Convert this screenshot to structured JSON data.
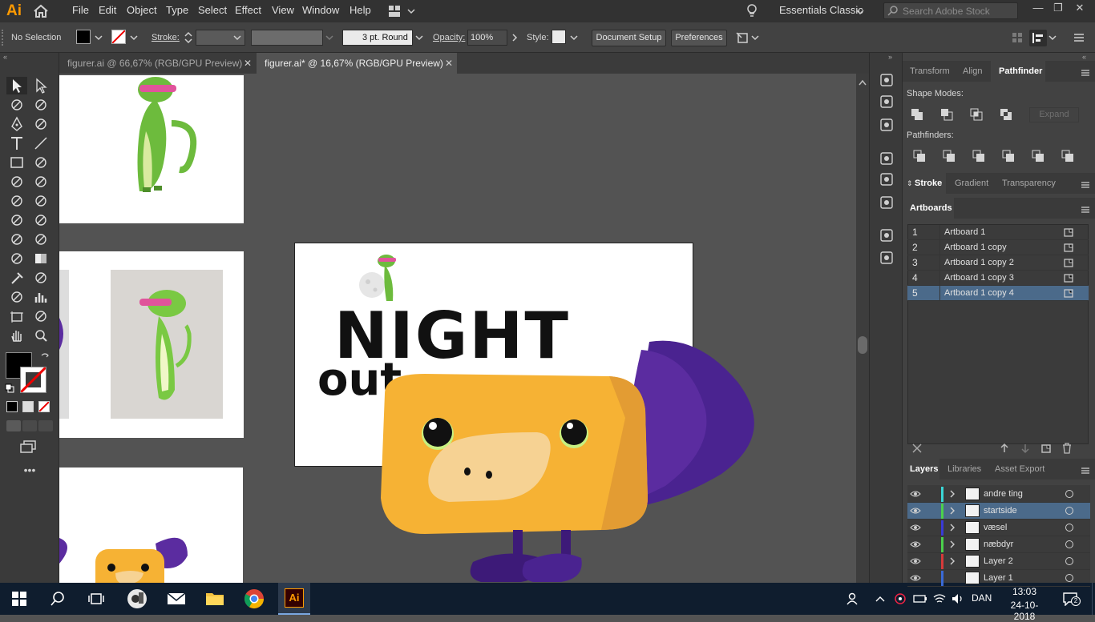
{
  "app": {
    "logo": "Ai"
  },
  "menu": {
    "items": [
      "File",
      "Edit",
      "Object",
      "Type",
      "Select",
      "Effect",
      "View",
      "Window",
      "Help"
    ]
  },
  "workspace": "Essentials Classic",
  "stock_search": {
    "placeholder": "Search Adobe Stock"
  },
  "control": {
    "selection": "No Selection",
    "stroke_label": "Stroke:",
    "brush": "3 pt. Round",
    "opacity_label": "Opacity:",
    "opacity_value": "100%",
    "style_label": "Style:",
    "document_setup": "Document Setup",
    "preferences": "Preferences"
  },
  "tabs": [
    {
      "label": "figurer.ai @ 66,67% (RGB/GPU Preview)",
      "active": false
    },
    {
      "label": "figurer.ai* @ 16,67% (RGB/GPU Preview)",
      "active": true
    }
  ],
  "artwork": {
    "title_line1": "NIGHT",
    "title_line2": "out"
  },
  "panels": {
    "top_tabs": [
      "Transform",
      "Align",
      "Pathfinder"
    ],
    "shape_modes_label": "Shape Modes:",
    "expand_label": "Expand",
    "pathfinders_label": "Pathfinders:",
    "mid_tabs": [
      "Stroke",
      "Gradient",
      "Transparency"
    ],
    "artboards_tab": "Artboards",
    "artboards": [
      {
        "num": "1",
        "name": "Artboard 1"
      },
      {
        "num": "2",
        "name": "Artboard 1 copy"
      },
      {
        "num": "3",
        "name": "Artboard 1 copy 2"
      },
      {
        "num": "4",
        "name": "Artboard 1 copy 3"
      },
      {
        "num": "5",
        "name": "Artboard 1 copy 4"
      }
    ],
    "layer_tabs": [
      "Layers",
      "Libraries",
      "Asset Export"
    ],
    "layers": [
      {
        "name": "andre ting",
        "color": "#3ad6d6"
      },
      {
        "name": "startside",
        "color": "#4cd04c"
      },
      {
        "name": "væsel",
        "color": "#3a3ad6"
      },
      {
        "name": "næbdyr",
        "color": "#4cd04c"
      },
      {
        "name": "Layer 2",
        "color": "#d63a3a"
      },
      {
        "name": "Layer 1",
        "color": "#3a6ad6"
      }
    ]
  },
  "taskbar": {
    "lang": "DAN",
    "time": "13:03",
    "date": "24-10-2018",
    "notifications": "2"
  },
  "colors": {
    "accent": "#ff9a00",
    "selected_row": "#4b6a8a",
    "weasel": "#6dbb3d",
    "platypus": "#f6b234",
    "platypus_tail": "#5b2ca0"
  }
}
